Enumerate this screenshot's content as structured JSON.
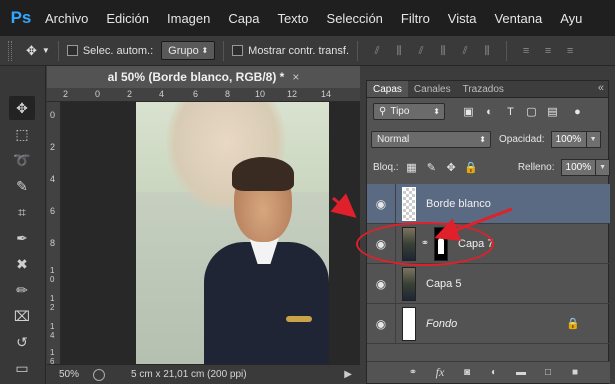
{
  "menubar": {
    "logo": "Ps",
    "items": [
      "Archivo",
      "Edición",
      "Imagen",
      "Capa",
      "Texto",
      "Selección",
      "Filtro",
      "Vista",
      "Ventana",
      "Ayu"
    ]
  },
  "options": {
    "auto_select_label": "Selec. autom.:",
    "group_value": "Grupo",
    "show_transform_label": "Mostrar contr. transf."
  },
  "document": {
    "tab_title": "al 50% (Borde blanco, RGB/8) *",
    "tab_close": "×",
    "ruler_h": [
      "2",
      "0",
      "2",
      "4",
      "6",
      "8",
      "10",
      "12",
      "14"
    ],
    "ruler_v": [
      "0",
      "2",
      "4",
      "6",
      "8",
      "1 0",
      "1 2",
      "1 4",
      "1 6"
    ],
    "zoom": "50%",
    "doc_size": "5 cm x 21,01 cm (200 ppi)"
  },
  "panel": {
    "tabs": [
      "Capas",
      "Canales",
      "Trazados"
    ],
    "close": "«",
    "filter_type": "Tipo",
    "blend_mode": "Normal",
    "opacity_label": "Opacidad:",
    "opacity_value": "100%",
    "lock_label": "Bloq.:",
    "fill_label": "Relleno:",
    "fill_value": "100%",
    "layers": [
      {
        "name": "Borde blanco",
        "selected": true
      },
      {
        "name": "Capa 7",
        "selected": false
      },
      {
        "name": "Capa 5",
        "selected": false
      },
      {
        "name": "Fondo",
        "selected": false
      }
    ]
  },
  "icons": {
    "eye": "eye-icon",
    "lock": "lock-icon",
    "link": "link-icon"
  },
  "colors": {
    "selected_layer": "#5a6a82",
    "annotation": "#e0202a",
    "ps_blue": "#31a8ff"
  }
}
